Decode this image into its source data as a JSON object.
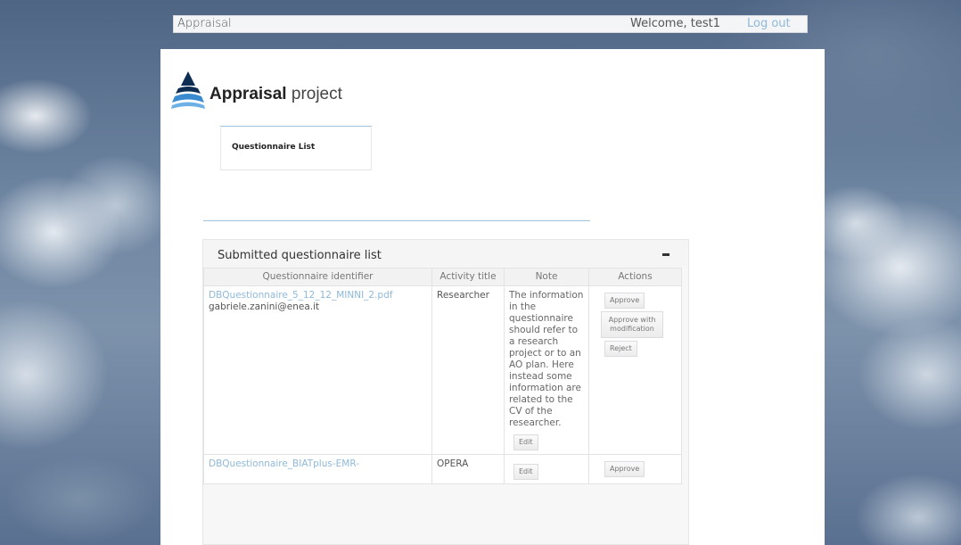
{
  "topbar": {
    "app_title": "Appraisal",
    "welcome": "Welcome, test1",
    "logout_label": "Log out"
  },
  "brand": {
    "name_bold": "Appraisal",
    "name_light": "project"
  },
  "nav": {
    "items": [
      {
        "label": "Questionnaire List"
      }
    ]
  },
  "list": {
    "title": "Submitted questionnaire list",
    "columns": [
      "Questionnaire identifier",
      "Activity title",
      "Note",
      "Actions"
    ],
    "rows": [
      {
        "identifier": "DBQuestionnaire_5_12_12_MINNI_2.pdf",
        "email": "gabriele.zanini@enea.it",
        "activity_title": "Researcher",
        "note": "The information in the questionnaire should refer to a research project or to an AO plan. Here instead some information are related to the CV of the researcher.",
        "edit_label": "Edit",
        "actions": [
          "Approve",
          "Approve with modification",
          "Reject"
        ]
      },
      {
        "identifier": "DBQuestionnaire_BIATplus-EMR-",
        "activity_title": "OPERA",
        "edit_label": "Edit",
        "actions": [
          "Approve"
        ]
      }
    ]
  },
  "colors": {
    "link": "#8fb9d9",
    "accent_rule": "#9fc3dc",
    "logo_dark": "#0d2d52",
    "logo_light": "#3a8ad0"
  }
}
